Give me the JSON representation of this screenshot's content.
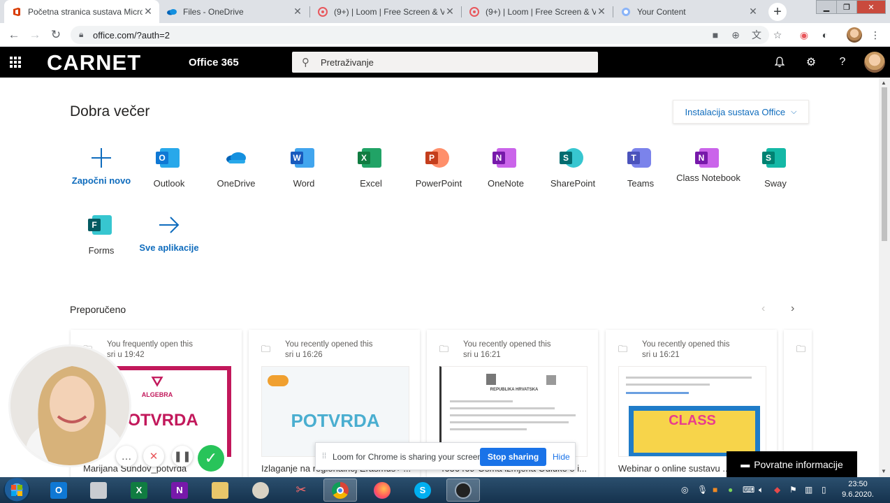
{
  "browser": {
    "tabs": [
      {
        "title": "Početna stranica sustava Micro",
        "active": true
      },
      {
        "title": "Files - OneDrive",
        "active": false
      },
      {
        "title": "(9+) | Loom | Free Screen & Vid",
        "active": false
      },
      {
        "title": "(9+) | Loom | Free Screen & Vid",
        "active": false
      },
      {
        "title": "Your Content",
        "active": false
      }
    ],
    "url": "office.com/?auth=2"
  },
  "header": {
    "brand": "CARNET",
    "suite_name": "Office 365",
    "search_placeholder": "Pretraživanje"
  },
  "main": {
    "greeting": "Dobra večer",
    "install_button": "Instalacija sustava Office",
    "apps": [
      {
        "label": "Započni novo",
        "icon": "plus-icon"
      },
      {
        "label": "Outlook",
        "icon": "outlook-icon",
        "color": "#0f78d4"
      },
      {
        "label": "OneDrive",
        "icon": "onedrive-icon",
        "color": "#0364b8"
      },
      {
        "label": "Word",
        "icon": "word-icon",
        "color": "#185abd"
      },
      {
        "label": "Excel",
        "icon": "excel-icon",
        "color": "#107c41"
      },
      {
        "label": "PowerPoint",
        "icon": "powerpoint-icon",
        "color": "#c43e1c"
      },
      {
        "label": "OneNote",
        "icon": "onenote-icon",
        "color": "#7719aa"
      },
      {
        "label": "SharePoint",
        "icon": "sharepoint-icon",
        "color": "#036c70"
      },
      {
        "label": "Teams",
        "icon": "teams-icon",
        "color": "#4b53bc"
      },
      {
        "label": "Class Notebook",
        "icon": "class-notebook-icon",
        "color": "#7719aa"
      },
      {
        "label": "Sway",
        "icon": "sway-icon",
        "color": "#008272"
      },
      {
        "label": "Forms",
        "icon": "forms-icon",
        "color": "#035a61"
      },
      {
        "label": "Sve aplikacije",
        "icon": "arrow-right-icon"
      }
    ],
    "recommended_title": "Preporučeno",
    "cards": [
      {
        "reason": "You frequently open this",
        "time": "sri u 19:42",
        "name": "Marijana Šundov_potvrda",
        "thumb_title": "POTVRDA",
        "thumb_brand": "ALGEBRA"
      },
      {
        "reason": "You recently opened this",
        "time": "sri u 16:26",
        "name": "Izlaganje na regionalnoj Erasmus+ ...",
        "thumb_title": "POTVRDA"
      },
      {
        "reason": "You recently opened this",
        "time": "sri u 16:21",
        "name": "4636469-Osma izmjena Odluke o i...",
        "thumb_title": "REPUBLIKA HRVATSKA"
      },
      {
        "reason": "You recently opened this",
        "time": "sri u 16:21",
        "name": "Webinar o online sustavu ...",
        "thumb_title": "CLASS"
      }
    ]
  },
  "loom": {
    "share_message": "Loom for Chrome is sharing your screen.",
    "stop_button": "Stop sharing",
    "hide_link": "Hide"
  },
  "feedback_button": "Povratne informacije",
  "taskbar": {
    "time": "23:50",
    "date": "9.6.2020."
  }
}
